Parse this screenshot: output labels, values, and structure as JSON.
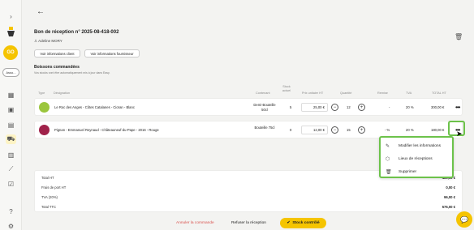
{
  "sidebar": {
    "pill_label": "Asso...",
    "go_label": "GO"
  },
  "header": {
    "title": "Bon de réception n° 2025-08-418-002",
    "author": "Adeline MORY",
    "btn_client": "Voir informations client",
    "btn_supplier": "Voir informations fournisseur"
  },
  "section": {
    "title": "Boissons commandées",
    "subtitle": "Vos stocks vont être automatiquement mis à jour dans Easy."
  },
  "table": {
    "headers": {
      "type": "Type",
      "designation": "Désignation",
      "contenant": "Contenant",
      "stock": "Stock actuel",
      "prix": "Prix unitaire HT",
      "quantite": "Quantité",
      "remise": "Remise",
      "tva": "TVA",
      "total": "TOTAL HT"
    },
    "rows": [
      {
        "designation": "Le Roc des Anges - Côtes Catalanes - Cioran - Blanc",
        "contenant": "Demi-Bouteille 50cl",
        "stock": "5",
        "prix": "25,00 €",
        "quantite": "12",
        "remise": "-",
        "tva": "20 %",
        "total": "300,00 €",
        "thumb_color": "#9bc63d"
      },
      {
        "designation": "Pignan - Emmanuel Reynaud - Châteauneuf-du-Pape - 2016 - Rouge",
        "contenant": "Bouteille 75cl",
        "stock": "0",
        "prix": "12,00 €",
        "quantite": "15",
        "remise": "- %",
        "tva": "20 %",
        "total": "180,00 €",
        "thumb_color": "#a0224a"
      }
    ]
  },
  "menu": {
    "items": [
      {
        "label": "Modifier les informations"
      },
      {
        "label": "Lieux de réceptions"
      },
      {
        "label": "Supprimer"
      }
    ]
  },
  "totals": {
    "items": [
      {
        "label": "Total HT",
        "value": "480,00 €"
      },
      {
        "label": "Frais de port HT",
        "value": "0,00 €"
      },
      {
        "label": "TVA (20%)",
        "value": "96,00 €"
      },
      {
        "label": "Total TTC",
        "value": "576,00 €"
      }
    ]
  },
  "footer": {
    "cancel": "Annuler la commande",
    "refuse": "Refuser la réception",
    "control": "Stock contrôlé"
  },
  "colors": {
    "accent": "#f5c400",
    "highlight": "#6cc24a",
    "danger": "#d9534f"
  }
}
